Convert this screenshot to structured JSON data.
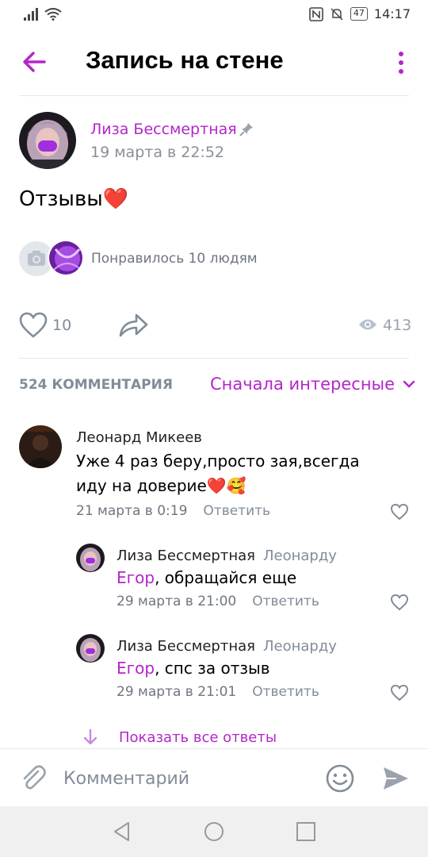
{
  "status_bar": {
    "time": "14:17",
    "battery": "47"
  },
  "header": {
    "title": "Запись на стене"
  },
  "post": {
    "author": "Лиза Бессмертная",
    "date": "19 марта в 22:52",
    "text": "Отзывы❤️",
    "likes_summary": "Понравилось 10 людям",
    "like_count": "10",
    "views": "413"
  },
  "comments_header": {
    "count_label": "524 КОММЕНТАРИЯ",
    "sort_label": "Сначала интересные"
  },
  "comments": [
    {
      "author": "Леонард Микеев",
      "text": "Уже 4 раз беру,просто зая,всегда иду на доверие❤️🥰",
      "date": "21 марта в 0:19",
      "reply_label": "Ответить"
    },
    {
      "author": "Лиза Бессмертная",
      "reply_to": "Леонарду",
      "mention": "Егор",
      "text": ", обращайся еще",
      "date": "29 марта в 21:00",
      "reply_label": "Ответить"
    },
    {
      "author": "Лиза Бессмертная",
      "reply_to": "Леонарду",
      "mention": "Егор",
      "text": ", спс за отзыв",
      "date": "29 марта в 21:01",
      "reply_label": "Ответить"
    }
  ],
  "show_replies_label": "Показать все ответы",
  "input": {
    "placeholder": "Комментарий"
  },
  "colors": {
    "accent": "#b326c9",
    "muted": "#818c99"
  }
}
